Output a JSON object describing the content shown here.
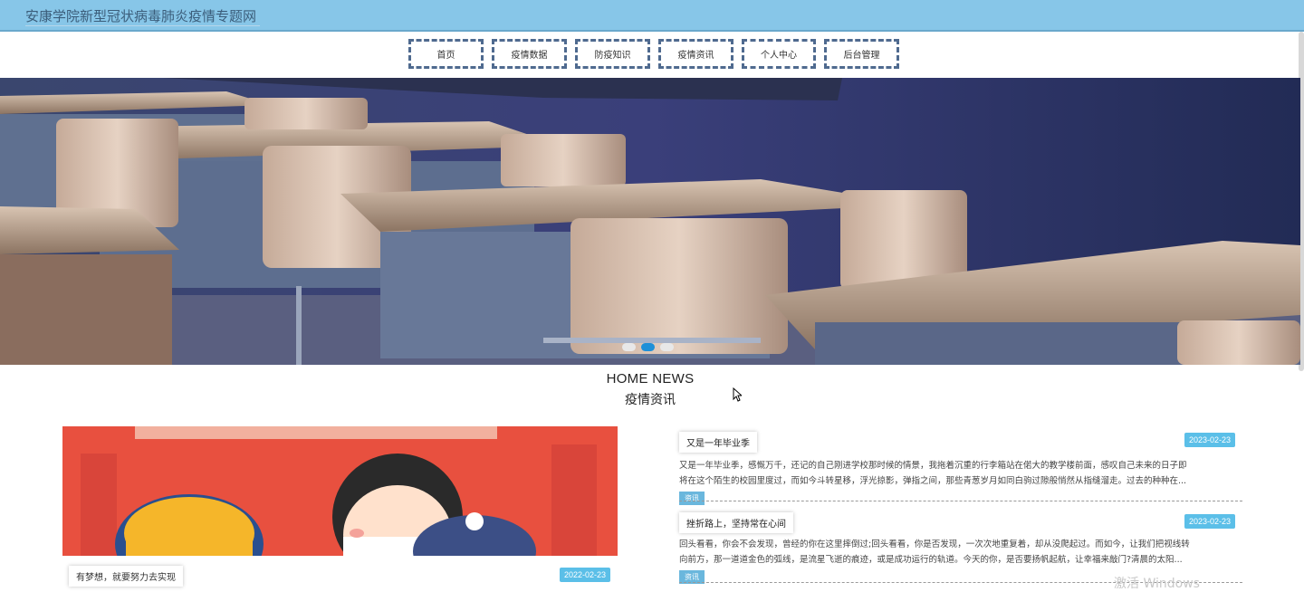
{
  "header": {
    "title": "安康学院新型冠状病毒肺炎疫情专题网"
  },
  "nav": {
    "items": [
      {
        "label": "首页"
      },
      {
        "label": "疫情数据"
      },
      {
        "label": "防疫知识"
      },
      {
        "label": "疫情资讯"
      },
      {
        "label": "个人中心"
      },
      {
        "label": "后台管理"
      }
    ]
  },
  "carousel": {
    "slide_count": 3,
    "active_index": 1,
    "active_color": "#1e90d8"
  },
  "news_section": {
    "title_en": "HOME NEWS",
    "title_zh": "疫情资讯"
  },
  "featured": {
    "caption": "有梦想，就要努力去实现",
    "date": "2022-02-23"
  },
  "news": [
    {
      "title": "又是一年毕业季",
      "date": "2023-02-23",
      "line1": "又是一年毕业季，感慨万千，还记的自己刚进学校那时候的情景，我拖着沉重的行李箱站在偌大的教学楼前面，感叹自己未来的日子即",
      "line2": "将在这个陌生的校园里度过，而如今斗转星移，浮光掠影，弹指之间，那些青葱岁月如同白驹过隙般悄然从指缝溜走。过去的种种在...",
      "tag": "资讯"
    },
    {
      "title": "挫折路上，坚持常在心间",
      "date": "2023-02-23",
      "line1": "回头看看，你会不会发现，曾经的你在这里摔倒过;回头看看，你是否发现，一次次地重复着，却从没爬起过。而如今，让我们把视线转",
      "line2": "向前方，那一道道金色的弧线，是流星飞逝的痕迹，或是成功运行的轨道。今天的你，是否要扬帆起航，让幸福来敲门?清晨的太阳...",
      "tag": "资讯"
    }
  ],
  "watermark": "激活 Windows",
  "colors": {
    "topbar": "#87c6e8",
    "nav_border": "#4f6a8f",
    "date_badge": "#5bbfe8"
  }
}
